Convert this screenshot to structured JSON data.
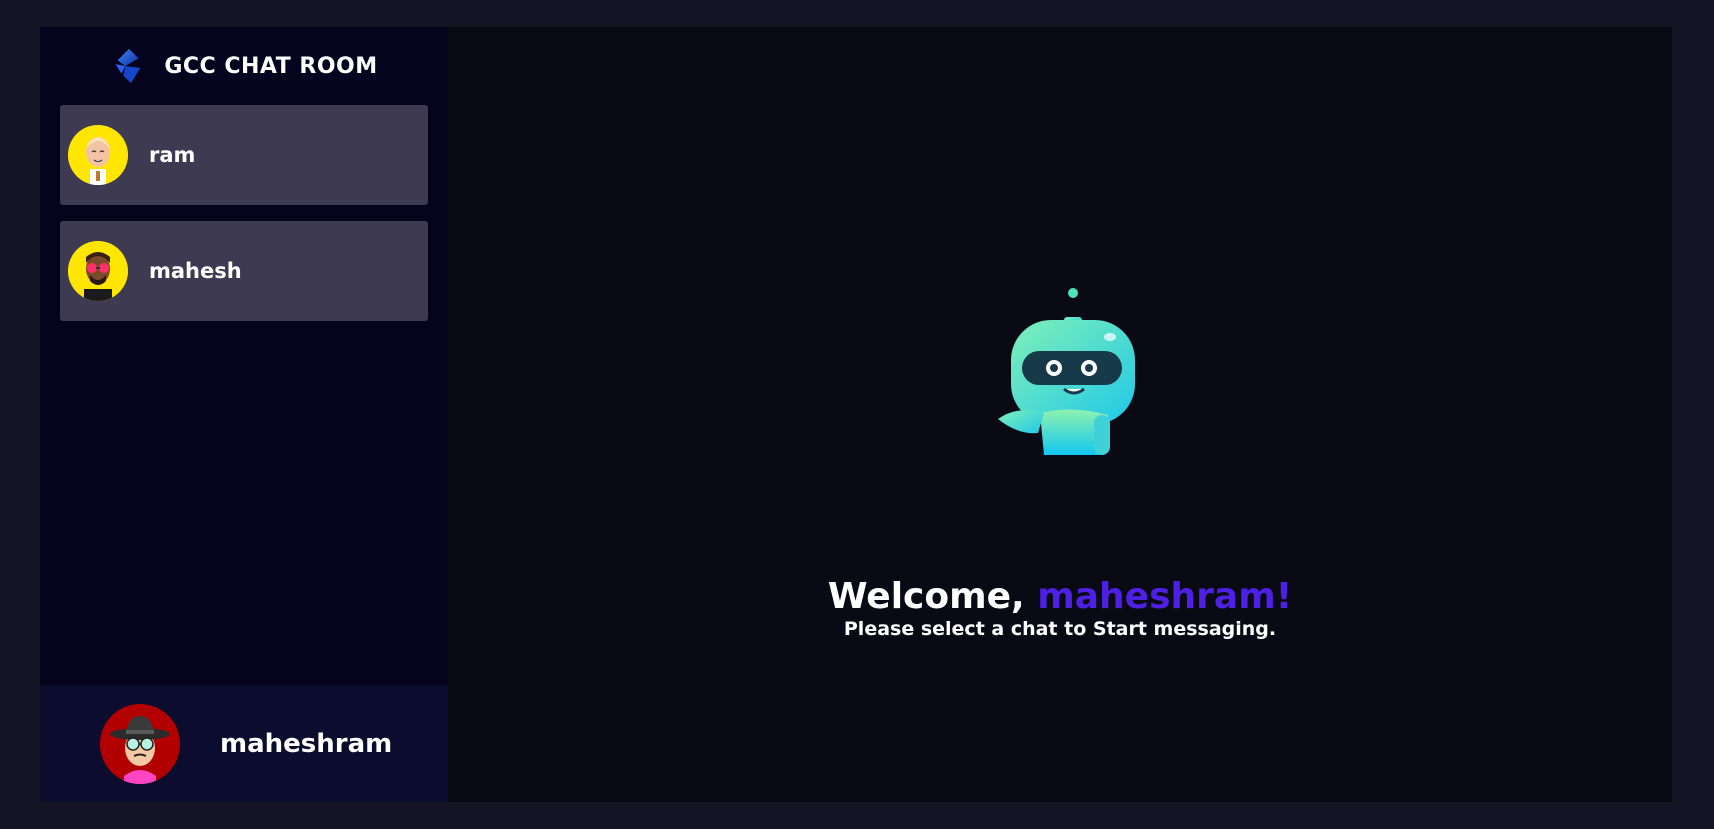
{
  "brand": {
    "title": "GCC CHAT ROOM",
    "logo_icon": "brand-logo-icon"
  },
  "contacts": [
    {
      "name": "ram",
      "avatar_icon": "avatar-ram-icon",
      "avatar_bg": "#ffe600"
    },
    {
      "name": "mahesh",
      "avatar_icon": "avatar-mahesh-icon",
      "avatar_bg": "#ffe600"
    }
  ],
  "current_user": {
    "name": "maheshram",
    "avatar_icon": "avatar-current-user-icon",
    "avatar_bg": "#b20000"
  },
  "welcome": {
    "greeting": "Welcome, ",
    "username": "maheshram!",
    "subtitle": "Please select a chat to Start messaging.",
    "illustration": "robot-icon"
  },
  "colors": {
    "page_bg": "#141424",
    "sidebar_bg": "#05031e",
    "contact_bg": "#3e3a51",
    "current_user_bg": "#0b0c2e",
    "main_bg": "#090a14",
    "accent": "#4e1fe5"
  }
}
